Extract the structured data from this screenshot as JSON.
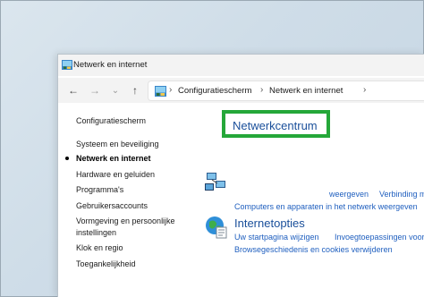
{
  "window": {
    "title": "Netwerk en internet"
  },
  "nav": {
    "back_icon": "←",
    "forward_icon": "→",
    "recent_icon": "⌄",
    "up_icon": "↑"
  },
  "address": {
    "crumbs": [
      "Configuratiescherm",
      "Netwerk en internet"
    ],
    "separator": "›"
  },
  "sidebar": {
    "items": [
      {
        "label": "Configuratiescherm"
      },
      {
        "label": "Systeem en beveiliging"
      },
      {
        "label": "Netwerk en internet",
        "active": true
      },
      {
        "label": "Hardware en geluiden"
      },
      {
        "label": "Programma's"
      },
      {
        "label": "Gebruikersaccounts"
      },
      {
        "label": "Vormgeving en persoonlijke"
      },
      {
        "label": "instellingen"
      },
      {
        "label": "Klok en regio"
      },
      {
        "label": "Toegankelijkheid"
      }
    ]
  },
  "categories": {
    "network_center": {
      "title": "Netwerkcentrum",
      "links": [
        "weergeven",
        "Verbinding m",
        "Computers en apparaten in het netwerk weergeven"
      ]
    },
    "internet_options": {
      "title": "Internetopties",
      "links": [
        "Uw startpagina wijzigen",
        "Invoegtoepassingen voor",
        "Browsegeschiedenis en cookies verwijderen"
      ]
    }
  },
  "colors": {
    "highlight": "#25a739",
    "link": "#1f5fbf",
    "category_title": "#1a4f9a"
  }
}
